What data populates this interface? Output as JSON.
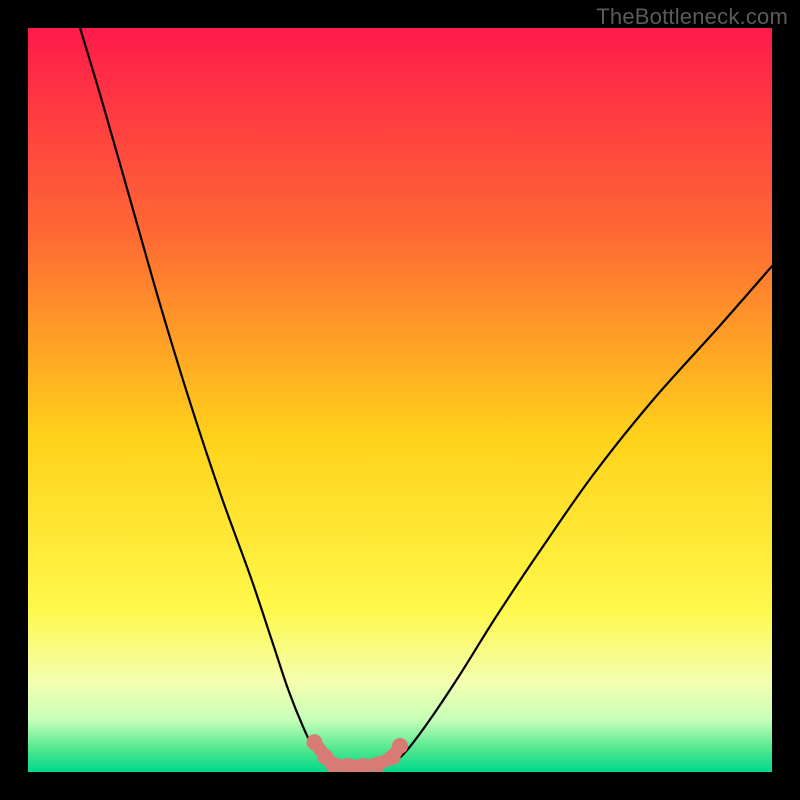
{
  "watermark": "TheBottleneck.com",
  "chart_data": {
    "type": "line",
    "title": "",
    "xlabel": "",
    "ylabel": "",
    "xlim": [
      0,
      100
    ],
    "ylim": [
      0,
      100
    ],
    "grid": false,
    "legend": false,
    "series": [
      {
        "name": "curve-left",
        "x": [
          7,
          10,
          14,
          18,
          22,
          26,
          30,
          33,
          35,
          37,
          38.5,
          40,
          41
        ],
        "y": [
          100,
          90,
          76,
          62,
          49,
          37,
          26,
          17,
          11,
          6,
          3,
          1.5,
          1
        ]
      },
      {
        "name": "flat-bottom",
        "x": [
          41,
          43,
          45,
          47,
          49
        ],
        "y": [
          1,
          0.8,
          0.8,
          0.9,
          1.2
        ]
      },
      {
        "name": "curve-right",
        "x": [
          49,
          51,
          54,
          58,
          63,
          69,
          76,
          84,
          93,
          100
        ],
        "y": [
          1.2,
          3,
          7,
          13,
          21,
          30,
          40,
          50,
          60,
          68
        ]
      },
      {
        "name": "salmon-dots",
        "x": [
          38.5,
          40,
          41,
          43,
          45,
          47,
          49,
          50
        ],
        "y": [
          4,
          2,
          1,
          0.8,
          0.8,
          1,
          2,
          3.5
        ]
      }
    ],
    "gradient_stops": [
      {
        "offset": 0,
        "color": "#ff1a4b"
      },
      {
        "offset": 28,
        "color": "#ff6a33"
      },
      {
        "offset": 55,
        "color": "#ffd21a"
      },
      {
        "offset": 78,
        "color": "#fff84a"
      },
      {
        "offset": 88,
        "color": "#f3ffb0"
      },
      {
        "offset": 93,
        "color": "#c6ffb8"
      },
      {
        "offset": 97,
        "color": "#4fe78f"
      },
      {
        "offset": 100,
        "color": "#00d88a"
      }
    ],
    "colors": {
      "curve": "#000000",
      "dots": "#d87b77",
      "background_frame": "#000000"
    }
  }
}
